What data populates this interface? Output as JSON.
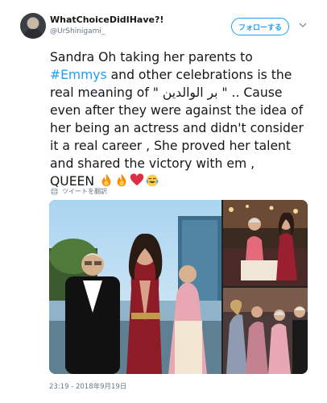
{
  "tweet": {
    "display_name": "WhatChoiceDidIHave?!",
    "handle": "@UrShinigami_",
    "follow_label": "フォローする",
    "text_lines": [
      "Sandra Oh taking her parents to",
      "and other celebrations is the",
      "real meaning of \" بر الوالدين \" .. Cause",
      "even after they were against the idea of",
      "her being an actress and didn't consider",
      "it a real career , She proved her talent",
      "and shared the victory with em ,",
      "QUEEN"
    ],
    "hashtag": "#Emmys",
    "emojis": [
      "fire-emoji",
      "fire-emoji",
      "red-heart-emoji",
      "tears-of-joy-emoji"
    ],
    "translate_label": "ツイートを翻訳",
    "timestamp": "23:19 - 2018年9月19日"
  },
  "icons": [
    "avatar",
    "chevron-down-icon",
    "globe-icon"
  ],
  "colors": {
    "accent": "#1da1f2",
    "secondary_text": "#657786",
    "text": "#14171a"
  }
}
